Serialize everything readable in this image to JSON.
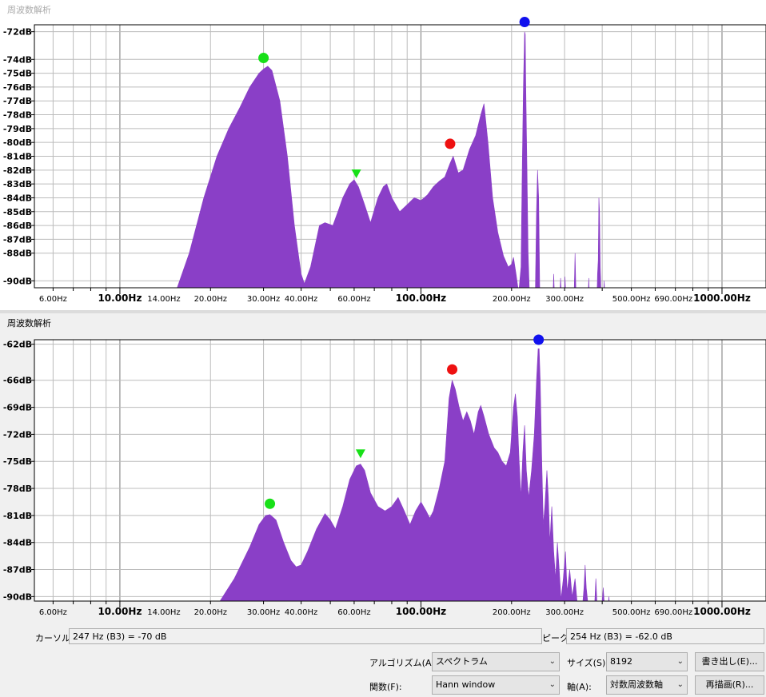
{
  "window_title": "周波数解析",
  "plots": [
    {
      "db_labels": [
        {
          "v": -72,
          "t": "-72dB"
        },
        {
          "v": -74,
          "t": "-74dB"
        },
        {
          "v": -75,
          "t": "-75dB"
        },
        {
          "v": -76,
          "t": "-76dB"
        },
        {
          "v": -77,
          "t": "-77dB"
        },
        {
          "v": -78,
          "t": "-78dB"
        },
        {
          "v": -79,
          "t": "-79dB"
        },
        {
          "v": -80,
          "t": "-80dB"
        },
        {
          "v": -81,
          "t": "-81dB"
        },
        {
          "v": -82,
          "t": "-82dB"
        },
        {
          "v": -83,
          "t": "-83dB"
        },
        {
          "v": -84,
          "t": "-84dB"
        },
        {
          "v": -85,
          "t": "-85dB"
        },
        {
          "v": -86,
          "t": "-86dB"
        },
        {
          "v": -87,
          "t": "-87dB"
        },
        {
          "v": -88,
          "t": "-88dB"
        },
        {
          "v": -90,
          "t": "-90dB"
        }
      ],
      "ylim": [
        -90.5,
        -71.5
      ],
      "spectrum": [
        [
          15.5,
          -90.5
        ],
        [
          17,
          -88
        ],
        [
          19,
          -84
        ],
        [
          21,
          -81
        ],
        [
          23,
          -79
        ],
        [
          25,
          -77.5
        ],
        [
          27,
          -76
        ],
        [
          29,
          -75
        ],
        [
          30,
          -74.7
        ],
        [
          31,
          -74.5
        ],
        [
          32,
          -74.8
        ],
        [
          34,
          -77
        ],
        [
          36,
          -81
        ],
        [
          38,
          -86
        ],
        [
          40,
          -89.5
        ],
        [
          41,
          -90.2
        ],
        [
          43,
          -89
        ],
        [
          46,
          -86
        ],
        [
          48,
          -85.8
        ],
        [
          51,
          -86
        ],
        [
          53,
          -85
        ],
        [
          55,
          -84
        ],
        [
          58,
          -83
        ],
        [
          60,
          -82.7
        ],
        [
          62,
          -83.2
        ],
        [
          65,
          -84.5
        ],
        [
          68,
          -85.8
        ],
        [
          72,
          -84
        ],
        [
          75,
          -83.2
        ],
        [
          77,
          -83
        ],
        [
          80,
          -84
        ],
        [
          85,
          -85
        ],
        [
          90,
          -84.5
        ],
        [
          95,
          -84
        ],
        [
          100,
          -84.2
        ],
        [
          105,
          -83.8
        ],
        [
          110,
          -83.2
        ],
        [
          115,
          -82.8
        ],
        [
          120,
          -82.5
        ],
        [
          125,
          -81.5
        ],
        [
          128,
          -81
        ],
        [
          133,
          -82.2
        ],
        [
          138,
          -82
        ],
        [
          145,
          -80.5
        ],
        [
          152,
          -79.5
        ],
        [
          158,
          -78
        ],
        [
          162,
          -77.2
        ],
        [
          167,
          -80
        ],
        [
          173,
          -84
        ],
        [
          180,
          -86.5
        ],
        [
          188,
          -88.2
        ],
        [
          195,
          -89
        ],
        [
          200,
          -88.8
        ],
        [
          203,
          -88.3
        ],
        [
          207,
          -89.5
        ],
        [
          210,
          -90.5
        ],
        [
          212,
          -90.5
        ],
        [
          215,
          -89
        ],
        [
          217,
          -82
        ],
        [
          219,
          -76
        ],
        [
          221,
          -72
        ],
        [
          222,
          -72.2
        ],
        [
          223,
          -76
        ],
        [
          225,
          -82
        ],
        [
          227,
          -88
        ],
        [
          229,
          -90.5
        ],
        [
          240,
          -90.5
        ],
        [
          242,
          -85
        ],
        [
          244,
          -82
        ],
        [
          246,
          -84
        ],
        [
          248,
          -90.5
        ],
        [
          275,
          -90.5
        ],
        [
          276,
          -89.5
        ],
        [
          277,
          -90.5
        ],
        [
          290,
          -90.5
        ],
        [
          291,
          -89.8
        ],
        [
          292,
          -90.5
        ],
        [
          300,
          -90.5
        ],
        [
          301,
          -89.7
        ],
        [
          302,
          -90.5
        ],
        [
          323,
          -90.5
        ],
        [
          325,
          -88
        ],
        [
          327,
          -90.5
        ],
        [
          360,
          -90.5
        ],
        [
          361,
          -89.8
        ],
        [
          362,
          -90.5
        ],
        [
          385,
          -90.5
        ],
        [
          386,
          -89.5
        ],
        [
          388,
          -88.5
        ],
        [
          390,
          -84
        ],
        [
          392,
          -85
        ],
        [
          394,
          -89
        ],
        [
          396,
          -90.5
        ],
        [
          405,
          -90.5
        ],
        [
          406,
          -90
        ],
        [
          407,
          -90.5
        ]
      ],
      "markers": [
        {
          "freq": 30,
          "db": -73.9,
          "color": "#18e018",
          "shape": "circle"
        },
        {
          "freq": 61,
          "db": -82.3,
          "color": "#18e018",
          "shape": "triangle"
        },
        {
          "freq": 125,
          "db": -80.1,
          "color": "#ee1111",
          "shape": "circle"
        },
        {
          "freq": 221,
          "db": -71.3,
          "color": "#1010ee",
          "shape": "circle"
        }
      ]
    },
    {
      "db_labels": [
        {
          "v": -62,
          "t": "-62dB"
        },
        {
          "v": -66,
          "t": "-66dB"
        },
        {
          "v": -69,
          "t": "-69dB"
        },
        {
          "v": -72,
          "t": "-72dB"
        },
        {
          "v": -75,
          "t": "-75dB"
        },
        {
          "v": -78,
          "t": "-78dB"
        },
        {
          "v": -81,
          "t": "-81dB"
        },
        {
          "v": -84,
          "t": "-84dB"
        },
        {
          "v": -87,
          "t": "-87dB"
        },
        {
          "v": -90,
          "t": "-90dB"
        }
      ],
      "ylim": [
        -90.5,
        -61.5
      ],
      "spectrum": [
        [
          21.5,
          -90.5
        ],
        [
          24,
          -88
        ],
        [
          27,
          -84.5
        ],
        [
          29,
          -82
        ],
        [
          30.5,
          -81
        ],
        [
          31.5,
          -80.9
        ],
        [
          33,
          -81.5
        ],
        [
          35,
          -84
        ],
        [
          37,
          -86
        ],
        [
          38.5,
          -86.7
        ],
        [
          40,
          -86.5
        ],
        [
          42,
          -85
        ],
        [
          45,
          -82.5
        ],
        [
          48,
          -80.8
        ],
        [
          50,
          -81.5
        ],
        [
          52,
          -82.5
        ],
        [
          55,
          -80
        ],
        [
          58,
          -77
        ],
        [
          61,
          -75.5
        ],
        [
          63,
          -75.3
        ],
        [
          65,
          -76
        ],
        [
          68,
          -78.5
        ],
        [
          72,
          -80
        ],
        [
          76,
          -80.5
        ],
        [
          80,
          -80
        ],
        [
          84,
          -79
        ],
        [
          88,
          -80.5
        ],
        [
          92,
          -82
        ],
        [
          96,
          -80.5
        ],
        [
          100,
          -79.5
        ],
        [
          104,
          -80.5
        ],
        [
          107,
          -81.3
        ],
        [
          110,
          -80.5
        ],
        [
          115,
          -78
        ],
        [
          120,
          -75
        ],
        [
          124,
          -68
        ],
        [
          127,
          -66
        ],
        [
          130,
          -67
        ],
        [
          134,
          -69
        ],
        [
          138,
          -70.5
        ],
        [
          142,
          -69.5
        ],
        [
          146,
          -70.5
        ],
        [
          150,
          -72
        ],
        [
          155,
          -69.5
        ],
        [
          158,
          -68.8
        ],
        [
          162,
          -70
        ],
        [
          168,
          -72
        ],
        [
          175,
          -73.5
        ],
        [
          180,
          -74
        ],
        [
          186,
          -75
        ],
        [
          192,
          -75.5
        ],
        [
          198,
          -74
        ],
        [
          203,
          -69
        ],
        [
          206,
          -67.5
        ],
        [
          209,
          -70
        ],
        [
          212,
          -75
        ],
        [
          215,
          -79
        ],
        [
          218,
          -74
        ],
        [
          221,
          -71
        ],
        [
          224,
          -76
        ],
        [
          228,
          -79
        ],
        [
          233,
          -76
        ],
        [
          238,
          -72
        ],
        [
          242,
          -66
        ],
        [
          245,
          -62.5
        ],
        [
          247,
          -62.5
        ],
        [
          249,
          -66
        ],
        [
          252,
          -75
        ],
        [
          255,
          -82
        ],
        [
          258,
          -80
        ],
        [
          262,
          -76
        ],
        [
          265,
          -79
        ],
        [
          268,
          -84
        ],
        [
          272,
          -80
        ],
        [
          276,
          -85
        ],
        [
          280,
          -88
        ],
        [
          284,
          -84
        ],
        [
          288,
          -87
        ],
        [
          292,
          -90.3
        ],
        [
          297,
          -88
        ],
        [
          302,
          -85
        ],
        [
          306,
          -89.5
        ],
        [
          312,
          -87
        ],
        [
          318,
          -90
        ],
        [
          325,
          -88
        ],
        [
          330,
          -90.5
        ],
        [
          345,
          -90.5
        ],
        [
          348,
          -89
        ],
        [
          351,
          -86.5
        ],
        [
          354,
          -89
        ],
        [
          358,
          -90.5
        ],
        [
          378,
          -90.5
        ],
        [
          381,
          -88
        ],
        [
          384,
          -90.5
        ],
        [
          400,
          -90.5
        ],
        [
          403,
          -89
        ],
        [
          406,
          -90.5
        ],
        [
          420,
          -90.5
        ],
        [
          421,
          -90
        ],
        [
          422,
          -90.5
        ]
      ],
      "markers": [
        {
          "freq": 31.5,
          "db": -79.7,
          "color": "#18e018",
          "shape": "circle"
        },
        {
          "freq": 63,
          "db": -74.2,
          "color": "#18e018",
          "shape": "triangle"
        },
        {
          "freq": 127,
          "db": -64.8,
          "color": "#ee1111",
          "shape": "circle"
        },
        {
          "freq": 246,
          "db": -61.5,
          "color": "#1010ee",
          "shape": "circle"
        }
      ]
    }
  ],
  "freq_labels": [
    {
      "f": 6,
      "t": "6.00Hz",
      "major": false
    },
    {
      "f": 10,
      "t": "10.00Hz",
      "major": true
    },
    {
      "f": 14,
      "t": "14.00Hz",
      "major": false
    },
    {
      "f": 20,
      "t": "20.00Hz",
      "major": false
    },
    {
      "f": 30,
      "t": "30.00Hz",
      "major": false
    },
    {
      "f": 40,
      "t": "40.00Hz",
      "major": false
    },
    {
      "f": 60,
      "t": "60.00Hz",
      "major": false
    },
    {
      "f": 100,
      "t": "100.00Hz",
      "major": true
    },
    {
      "f": 200,
      "t": "200.00Hz",
      "major": false
    },
    {
      "f": 300,
      "t": "300.00Hz",
      "major": false
    },
    {
      "f": 500,
      "t": "500.00Hz",
      "major": false
    },
    {
      "f": 690,
      "t": "690.00Hz",
      "major": false
    },
    {
      "f": 1000,
      "t": "1000.00Hz",
      "major": true
    }
  ],
  "colors": {
    "fill": "#8a3fc7",
    "grid": "#bcbcbc",
    "grid_major": "#777777"
  },
  "cursor": {
    "label": "カーソル:",
    "value": "247 Hz (B3) = -70 dB"
  },
  "peak": {
    "label": "ピーク:",
    "value": "254 Hz (B3) = -62.0 dB"
  },
  "controls": {
    "algorithm": {
      "label": "アルゴリズム(A):",
      "value": "スペクトラム"
    },
    "size": {
      "label": "サイズ(S):",
      "value": "8192"
    },
    "export_button": "書き出し(E)...",
    "function": {
      "label": "関数(F):",
      "value": "Hann window"
    },
    "axis": {
      "label": "軸(A):",
      "value": "対数周波数軸"
    },
    "replot_button": "再描画(R)..."
  }
}
